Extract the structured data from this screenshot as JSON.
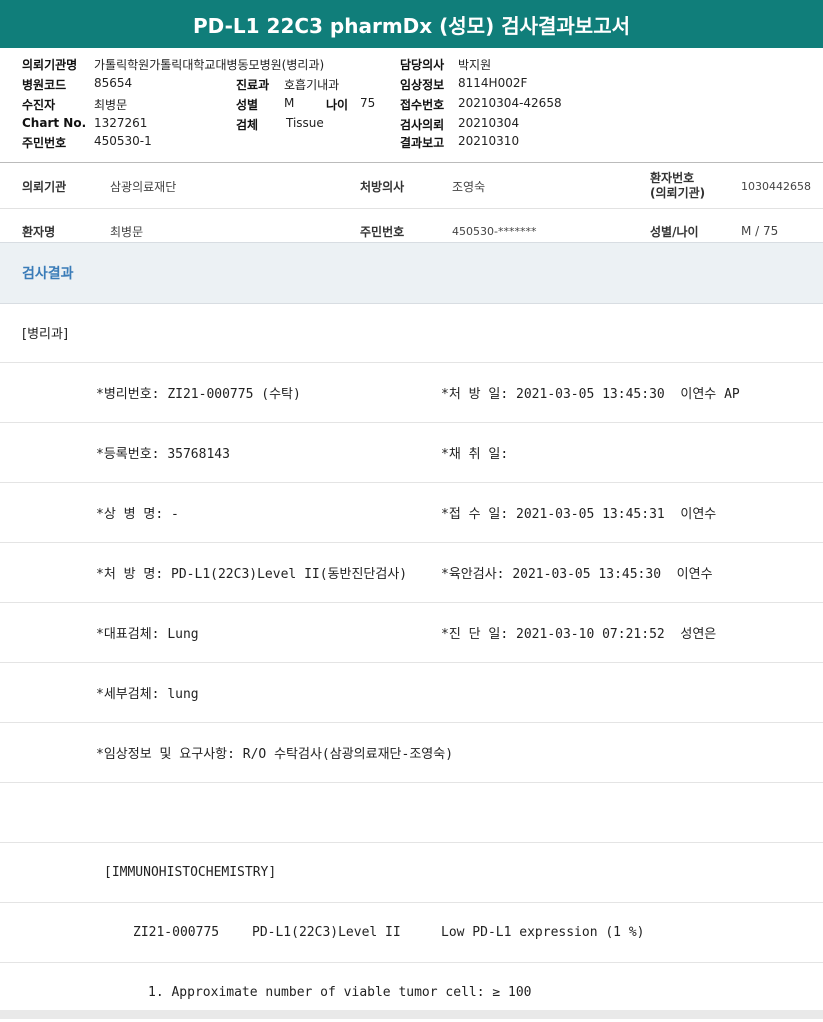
{
  "title": "PD-L1 22C3 pharmDx (성모) 검사결과보고서",
  "header": {
    "left": [
      {
        "label": "의뢰기관명",
        "value": "가톨릭학원가톨릭대학교대병동모병원(병리과)"
      },
      {
        "label": "병원코드",
        "value": "85654"
      },
      {
        "label": "수진자",
        "value": "최병문"
      },
      {
        "label": "Chart No.",
        "value": "1327261"
      },
      {
        "label": "주민번호",
        "value": "450530-1"
      }
    ],
    "mid": [
      {
        "label": "진료과",
        "value": "호흡기내과"
      },
      {
        "label": "성별",
        "value": "M"
      },
      {
        "label": "검체",
        "value": "Tissue"
      }
    ],
    "age": {
      "label": "나이",
      "value": "75"
    },
    "right": [
      {
        "label": "담당의사",
        "value": "박지원"
      },
      {
        "label": "임상정보",
        "value": "8114H002F"
      },
      {
        "label": "접수번호",
        "value": "20210304-42658"
      },
      {
        "label": "검사의뢰",
        "value": "20210304"
      },
      {
        "label": "결과보고",
        "value": "20210310"
      }
    ]
  },
  "info": {
    "row1": {
      "inst_label": "의뢰기관",
      "inst_value": "삼광의료재단",
      "doc_label": "처방의사",
      "doc_value": "조영숙",
      "pid_label_1": "환자번호",
      "pid_label_2": "(의뢰기관)",
      "pid_value": "1030442658"
    },
    "row2": {
      "name_label": "환자명",
      "name_value": "최병문",
      "rrn_label": "주민번호",
      "rrn_value": "450530-*******",
      "sex_label": "성별/나이",
      "sex_value": "M / 75"
    }
  },
  "section_title": "검사결과",
  "dept": "[병리과]",
  "results": {
    "r1_left": "*병리번호: ZI21-000775 (수탁)",
    "r1_right": "*처 방 일: 2021-03-05 13:45:30  이연수 AP",
    "r2_left": "*등록번호: 35768143",
    "r2_right": "*채 취 일:",
    "r3_left": "*상 병 명: -",
    "r3_right": "*접 수 일: 2021-03-05 13:45:31  이연수",
    "r4_left": "*처 방 명: PD-L1(22C3)Level II(동반진단검사)",
    "r4_right": "*육안검사: 2021-03-05 13:45:30  이연수",
    "r5_left": "*대표검체: Lung",
    "r5_right": "*진 단 일: 2021-03-10 07:21:52  성연은",
    "r6_left": "*세부검체: lung",
    "r7_left": "*임상정보 및 요구사항: R/O 수탁검사(삼광의료재단-조영숙)",
    "ihc_title": "[IMMUNOHISTOCHEMISTRY]",
    "ihc_no": "ZI21-000775",
    "ihc_test": "PD-L1(22C3)Level II",
    "ihc_result": "Low PD-L1 expression (1 %)",
    "ihc_item1": "1. Approximate number of viable tumor cell: ≥ 100"
  }
}
